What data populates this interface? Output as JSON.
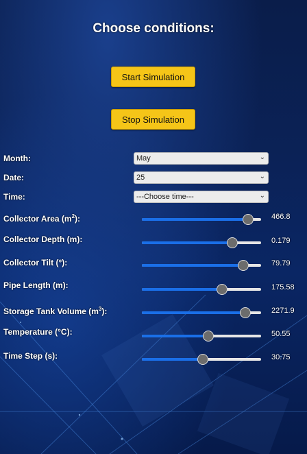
{
  "title": "Choose conditions:",
  "buttons": {
    "start": "Start Simulation",
    "stop": "Stop Simulation"
  },
  "selects": [
    {
      "label": "Month:",
      "value": "May"
    },
    {
      "label": "Date:",
      "value": "25"
    },
    {
      "label": "Time:",
      "value": "---Choose time---"
    }
  ],
  "sliders": [
    {
      "label": "Collector Area (m",
      "sup": "2",
      "suffix": "):",
      "value": "466.8",
      "level": 0.89
    },
    {
      "label": "Collector Depth (m):",
      "sup": "",
      "suffix": "",
      "value": "0.179",
      "level": 0.76
    },
    {
      "label": "Collector Tilt (°):",
      "sup": "",
      "suffix": "",
      "value": "79.79",
      "level": 0.85
    },
    {
      "label": "Pipe Length (m):",
      "sup": "",
      "suffix": "",
      "value": "175.58",
      "level": 0.67
    },
    {
      "label": "Storage Tank Volume (m",
      "sup": "3",
      "suffix": "):",
      "value": "2271.9",
      "level": 0.87
    },
    {
      "label": "Temperature (°C):",
      "sup": "",
      "suffix": "",
      "value": "50.55",
      "level": 0.56
    },
    {
      "label": "Time Step (s):",
      "sup": "",
      "suffix": "",
      "value": "30.75",
      "level": 0.51
    }
  ],
  "colors": {
    "button": "#f5c518",
    "slider_fill": "#1a6fe8",
    "background": "#0b2257"
  },
  "icons": {
    "select_arrow": "chevron-down-icon"
  }
}
